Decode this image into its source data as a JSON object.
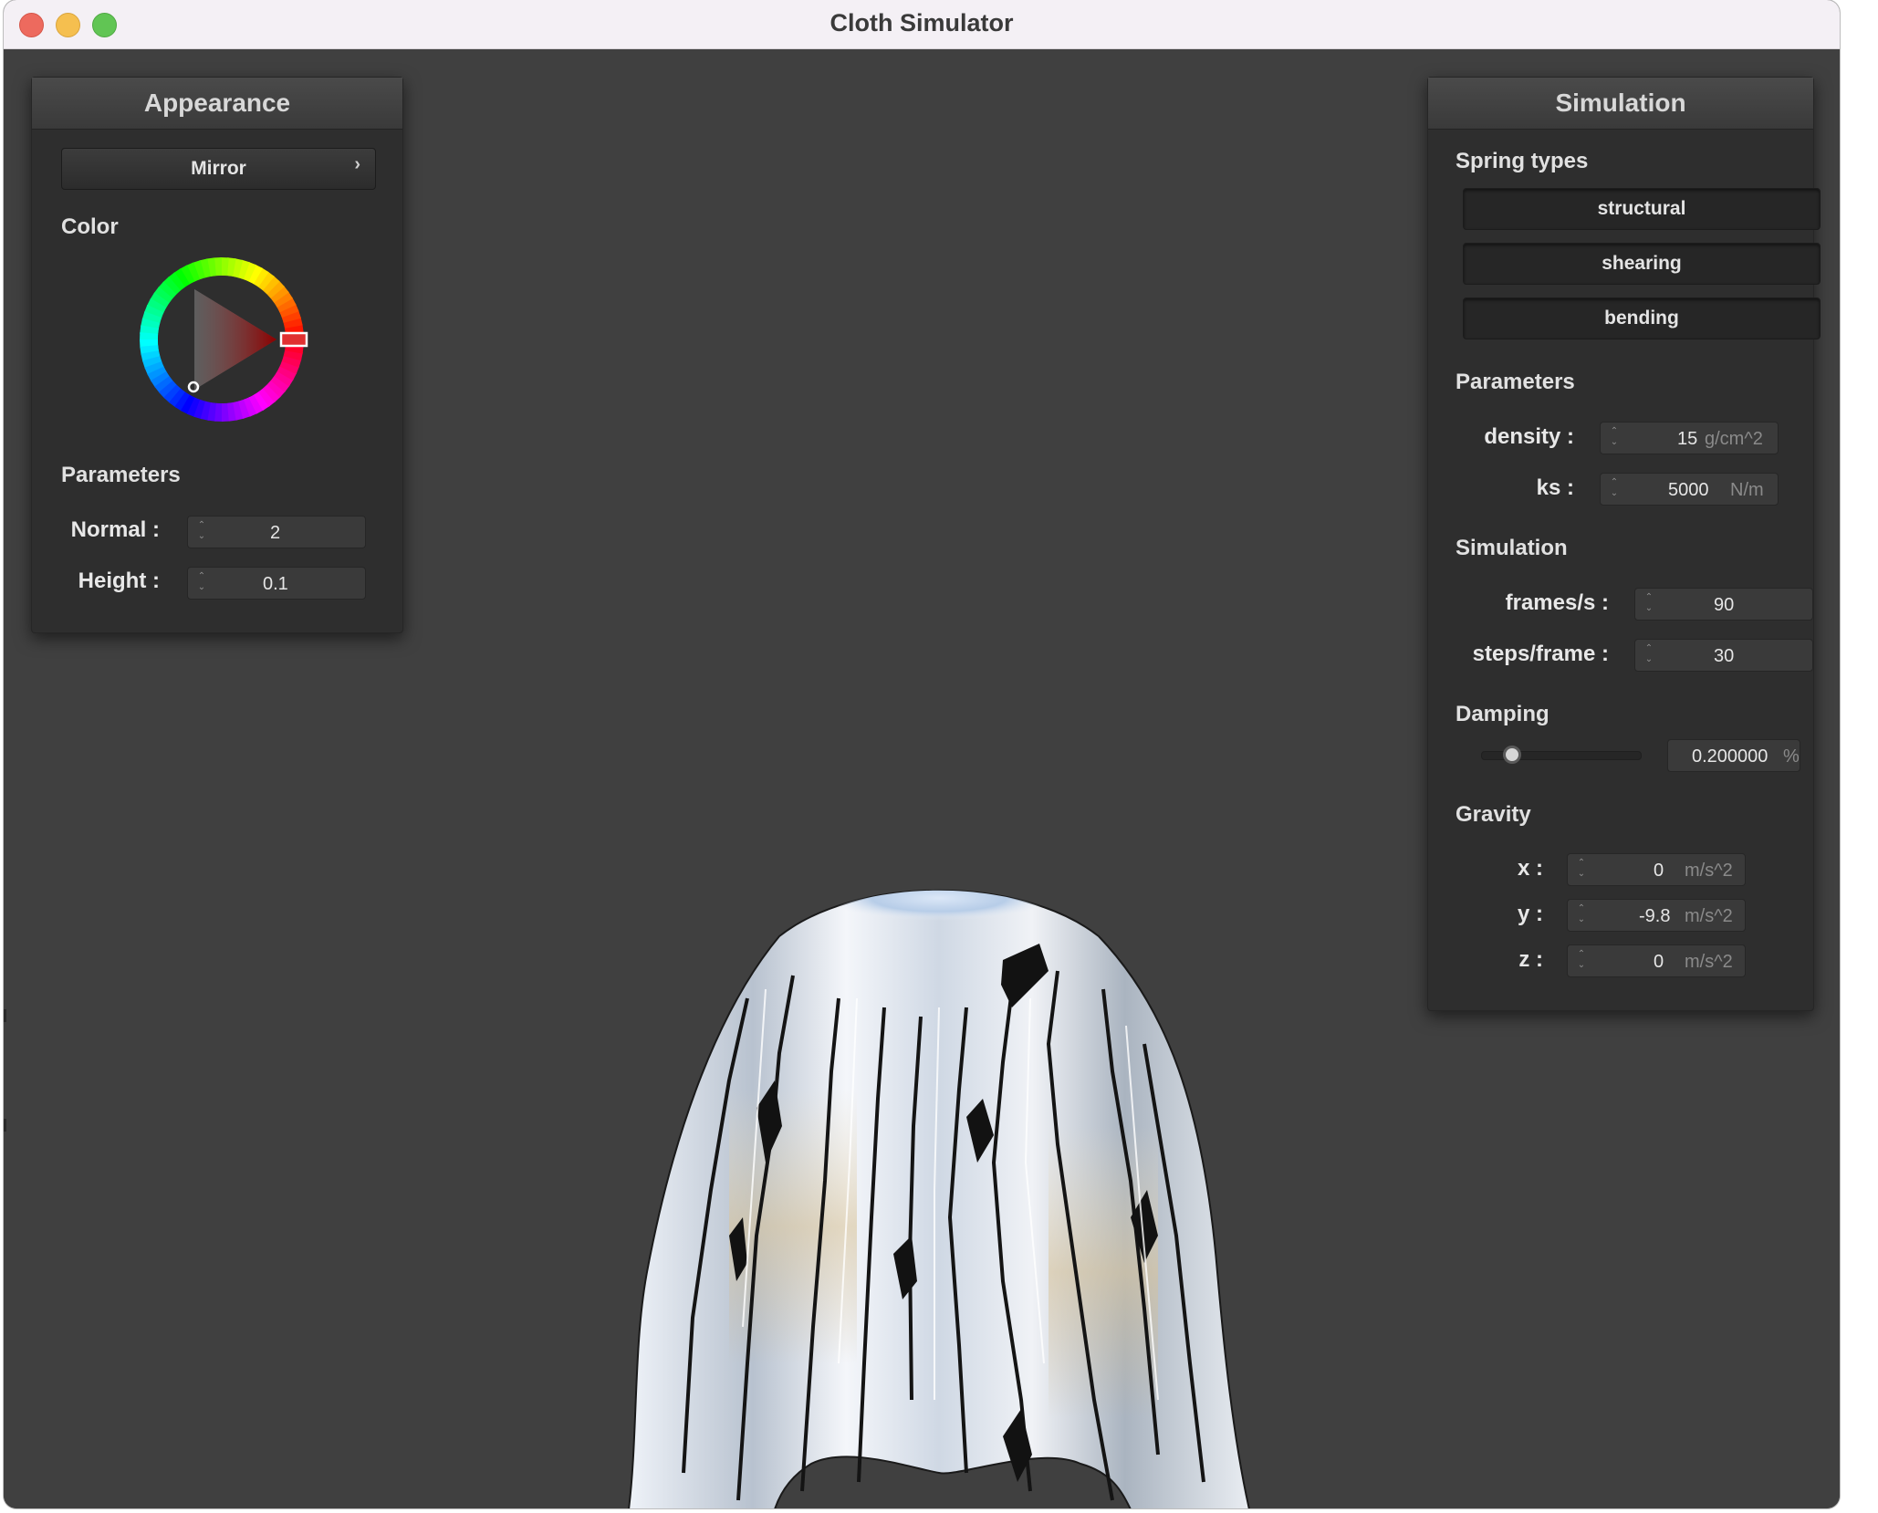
{
  "window": {
    "title": "Cloth Simulator"
  },
  "appearance": {
    "header": "Appearance",
    "shader": {
      "selected": "Mirror",
      "arrow": "›"
    },
    "color_label": "Color",
    "color": {
      "hue": "#ff0000",
      "saturation_percent": 0,
      "value_percent": 0
    },
    "parameters_label": "Parameters",
    "normal": {
      "label": "Normal :",
      "value": "2"
    },
    "height": {
      "label": "Height :",
      "value": "0.1"
    }
  },
  "simulation": {
    "header": "Simulation",
    "spring_types_label": "Spring types",
    "springs": [
      {
        "label": "structural",
        "active": true
      },
      {
        "label": "shearing",
        "active": true
      },
      {
        "label": "bending",
        "active": true
      }
    ],
    "parameters_label": "Parameters",
    "density": {
      "label": "density :",
      "value": "15",
      "unit": "g/cm^2"
    },
    "ks": {
      "label": "ks :",
      "value": "5000",
      "unit": "N/m"
    },
    "simulation_label": "Simulation",
    "fps": {
      "label": "frames/s :",
      "value": "90"
    },
    "steps": {
      "label": "steps/frame :",
      "value": "30"
    },
    "damping_label": "Damping",
    "damping": {
      "value": "0.200000",
      "unit": "%",
      "slider_fraction": 0.2
    },
    "gravity_label": "Gravity",
    "gravity": [
      {
        "axis": "x :",
        "value": "0",
        "unit": "m/s^2"
      },
      {
        "axis": "y :",
        "value": "-9.8",
        "unit": "m/s^2"
      },
      {
        "axis": "z :",
        "value": "0",
        "unit": "m/s^2"
      }
    ]
  },
  "icons": {
    "close": "close-icon",
    "minimize": "minimize-icon",
    "maximize": "maximize-icon",
    "spinner": "spinner-icon",
    "chevron": "chevron-right-icon"
  },
  "colors": {
    "background": "#404040",
    "panel": "#2e2e2e",
    "panel_header": "#424242",
    "close": "#ed6a5e",
    "minimize": "#f5bf4f",
    "maximize": "#61c554"
  }
}
